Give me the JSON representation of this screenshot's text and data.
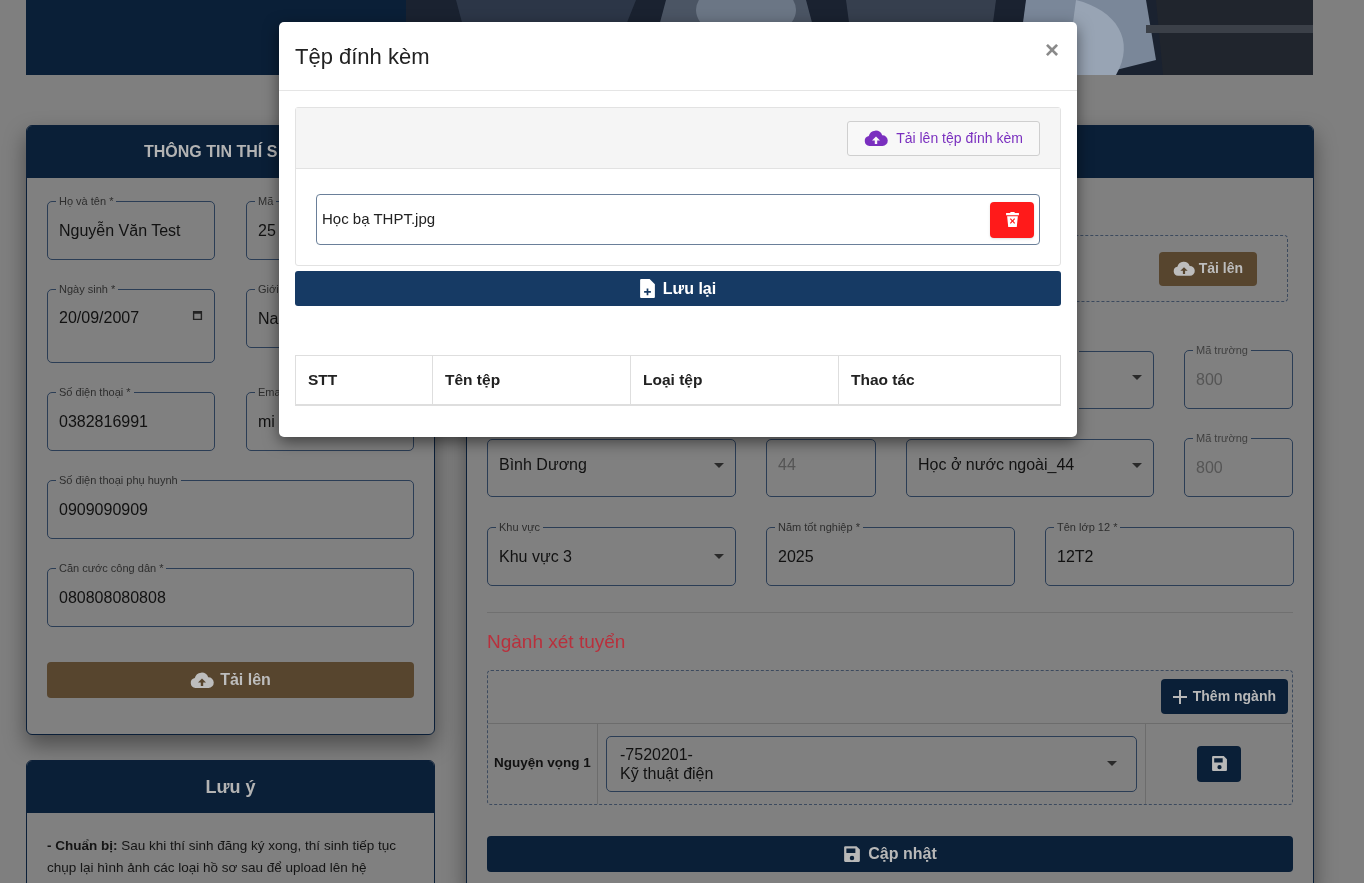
{
  "candidate_card": {
    "title": "THÔNG TIN THÍ S",
    "fields": [
      {
        "label": "Họ và tên *",
        "value": "Nguyễn Văn Test",
        "kind": "text"
      },
      {
        "label": "Mã",
        "value": "25",
        "kind": "text"
      },
      {
        "label": "Ngày sinh *",
        "value": "20/09/2007",
        "kind": "date"
      },
      {
        "label": "Giới",
        "value": "Na",
        "kind": "text"
      },
      {
        "label": "Số điện thoại *",
        "value": "0382816991",
        "kind": "text"
      },
      {
        "label": "Ema",
        "value": "mi",
        "kind": "text"
      },
      {
        "label": "Số điện thoại phụ huynh",
        "value": "0909090909",
        "kind": "text"
      },
      {
        "label": "Căn cước công dân *",
        "value": "080808080808",
        "kind": "text"
      }
    ],
    "upload_button": "Tải lên"
  },
  "notes_card": {
    "title": "Lưu ý",
    "text": "**- Chuẩn bị:** Sau khi thí sinh đăng ký xong, thí sinh tiếp tục chụp lại hình ảnh các loại hồ sơ sau để upload lên hệ"
  },
  "school_card": {
    "upload_button": "Tải lên",
    "rows": [
      [
        "",
        "",
        {
          "kind": "select"
        },
        {
          "label": "Mã trường",
          "value": "800",
          "kind": "text",
          "disabled": true
        }
      ],
      [
        {
          "value": "Bình Dương",
          "kind": "select",
          "disabled": false
        },
        {
          "value": "44",
          "kind": "text",
          "disabled": true
        },
        {
          "value": "Học ở nước ngoài_44",
          "kind": "select",
          "disabled": false
        },
        {
          "label": "Mã trường",
          "value": "800",
          "kind": "text",
          "disabled": true
        }
      ],
      [
        {
          "label": "Khu vực",
          "value": "Khu vực 3",
          "kind": "select",
          "disabled": false
        },
        {
          "label": "Năm tốt nghiệp *",
          "value": "2025",
          "kind": "text",
          "disabled": false
        },
        {
          "label": "Tên lớp 12 *",
          "value": "12T2",
          "kind": "text",
          "disabled": false
        }
      ]
    ],
    "majors_title": "Ngành xét tuyển",
    "add_major_button": "Thêm ngành",
    "wishes": [
      {
        "label": "Nguyện vọng 1",
        "code": "-7520201-",
        "name": "Kỹ thuật điện"
      }
    ],
    "update_button": "Cập nhật"
  },
  "modal": {
    "title": "Tệp đính kèm",
    "close": "×",
    "upload_button": "Tải lên tệp đính kèm",
    "files": [
      {
        "name": "Học bạ THPT.jpg"
      }
    ],
    "save_button": "Lưu lại",
    "table": {
      "columns": [
        "STT",
        "Tên tệp",
        "Loại tệp",
        "Thao tác"
      ]
    }
  }
}
